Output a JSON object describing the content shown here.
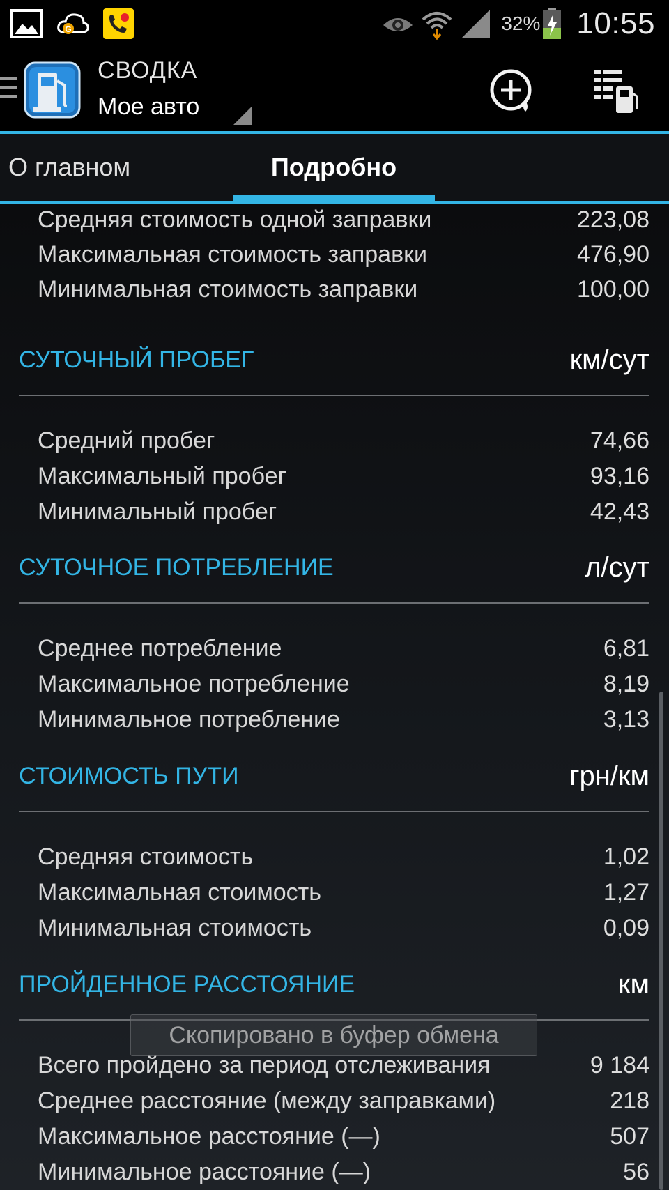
{
  "status_bar": {
    "left_icons": [
      "gallery-icon",
      "cloud-g-icon",
      "call-recorder-icon"
    ],
    "right_icons": [
      "eye-icon",
      "wifi-icon",
      "signal-icon",
      "battery-charging-icon"
    ],
    "battery_percent": "32%",
    "time": "10:55"
  },
  "action_bar": {
    "title": "СВОДКА",
    "subtitle": "Мое авто",
    "icons": [
      "fuel-pump-app-icon",
      "add-refuel-icon",
      "fuel-list-icon"
    ]
  },
  "tabs": [
    {
      "label": "О главном",
      "selected": false
    },
    {
      "label": "Подробно",
      "selected": true
    }
  ],
  "accent_color": "#33b5e5",
  "top_rows": [
    {
      "label": "Средняя стоимость одной заправки",
      "value": "223,08"
    },
    {
      "label": "Максимальная стоимость заправки",
      "value": "476,90"
    },
    {
      "label": "Минимальная стоимость заправки",
      "value": "100,00"
    }
  ],
  "sections": [
    {
      "title": "СУТОЧНЫЙ ПРОБЕГ",
      "unit": "км/сут",
      "rows": [
        {
          "label": "Средний пробег",
          "value": "74,66"
        },
        {
          "label": "Максимальный пробег",
          "value": "93,16"
        },
        {
          "label": "Минимальный пробег",
          "value": "42,43"
        }
      ]
    },
    {
      "title": "СУТОЧНОЕ ПОТРЕБЛЕНИЕ",
      "unit": "л/сут",
      "rows": [
        {
          "label": "Среднее потребление",
          "value": "6,81"
        },
        {
          "label": "Максимальное потребление",
          "value": "8,19"
        },
        {
          "label": "Минимальное потребление",
          "value": "3,13"
        }
      ]
    },
    {
      "title": "СТОИМОСТЬ ПУТИ",
      "unit": "грн/км",
      "rows": [
        {
          "label": "Средняя стоимость",
          "value": "1,02"
        },
        {
          "label": "Максимальная стоимость",
          "value": "1,27"
        },
        {
          "label": "Минимальная стоимость",
          "value": "0,09"
        }
      ]
    },
    {
      "title": "ПРОЙДЕННОЕ РАССТОЯНИЕ",
      "unit": "км",
      "rows": [
        {
          "label": "Всего пройдено за период отслеживания",
          "value": "9 184"
        },
        {
          "label": "Среднее расстояние (между заправками)",
          "value": "218"
        },
        {
          "label": "Максимальное расстояние (—)",
          "value": "507"
        },
        {
          "label": "Минимальное расстояние (—)",
          "value": "56"
        }
      ]
    }
  ],
  "toast": "Скопировано в буфер обмена"
}
